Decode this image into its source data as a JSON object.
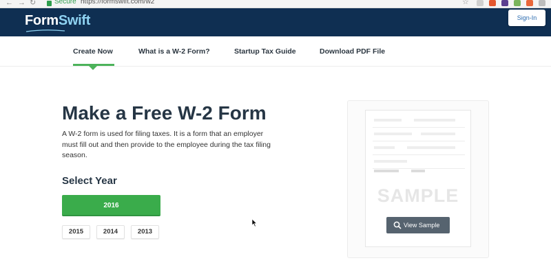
{
  "browser": {
    "secure_label": "Secure",
    "url": "https://formswift.com/w2"
  },
  "header": {
    "logo_part1": "Form",
    "logo_part2": "Swift",
    "signin_label": "Sign-In"
  },
  "nav": {
    "items": [
      {
        "label": "Create Now",
        "active": true
      },
      {
        "label": "What is a W-2 Form?",
        "active": false
      },
      {
        "label": "Startup Tax Guide",
        "active": false
      },
      {
        "label": "Download PDF File",
        "active": false
      }
    ]
  },
  "main": {
    "title": "Make a Free W-2 Form",
    "description": "A W-2 form is used for filing taxes. It is a form that an employer must fill out and then provide to the employee during the tax filing season.",
    "select_year_heading": "Select Year",
    "years": [
      "2016",
      "2015",
      "2014",
      "2013"
    ]
  },
  "preview": {
    "sample_watermark": "SAMPLE",
    "view_sample_label": "View Sample"
  },
  "colors": {
    "brand_navy": "#0f2f52",
    "accent_green": "#3aac4b",
    "view_button": "#56636f"
  }
}
